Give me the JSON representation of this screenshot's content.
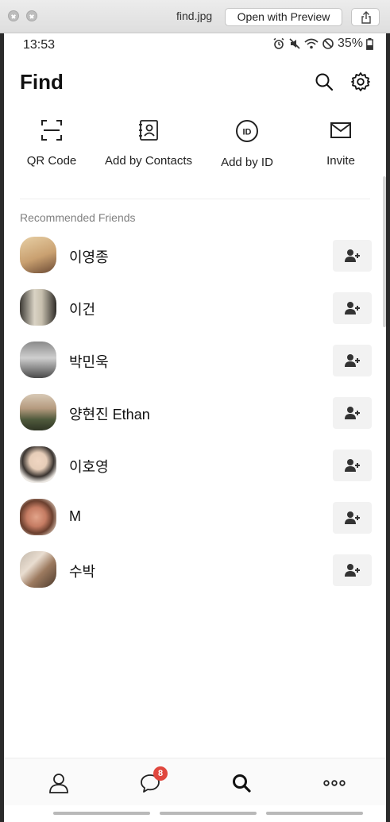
{
  "window": {
    "filename": "find.jpg",
    "open_with_label": "Open with Preview"
  },
  "statusbar": {
    "time": "13:53",
    "battery": "35%"
  },
  "header": {
    "title": "Find"
  },
  "quick_actions": [
    {
      "label": "QR Code",
      "icon": "qr-scan-icon"
    },
    {
      "label": "Add by Contacts",
      "icon": "contacts-book-icon"
    },
    {
      "label": "Add by ID",
      "icon": "id-circle-icon"
    },
    {
      "label": "Invite",
      "icon": "envelope-icon"
    }
  ],
  "recommended": {
    "label": "Recommended Friends",
    "friends": [
      {
        "name": "이영종"
      },
      {
        "name": "이건"
      },
      {
        "name": "박민욱"
      },
      {
        "name": "양현진 Ethan"
      },
      {
        "name": "이호영"
      },
      {
        "name": "M"
      },
      {
        "name": "수박"
      }
    ]
  },
  "bottom_nav": {
    "chat_badge": "8",
    "items": [
      "friends-icon",
      "chat-icon",
      "search-icon",
      "more-icon"
    ]
  },
  "colors": {
    "badge": "#e0473e",
    "add_button_bg": "#f2f2f2"
  }
}
